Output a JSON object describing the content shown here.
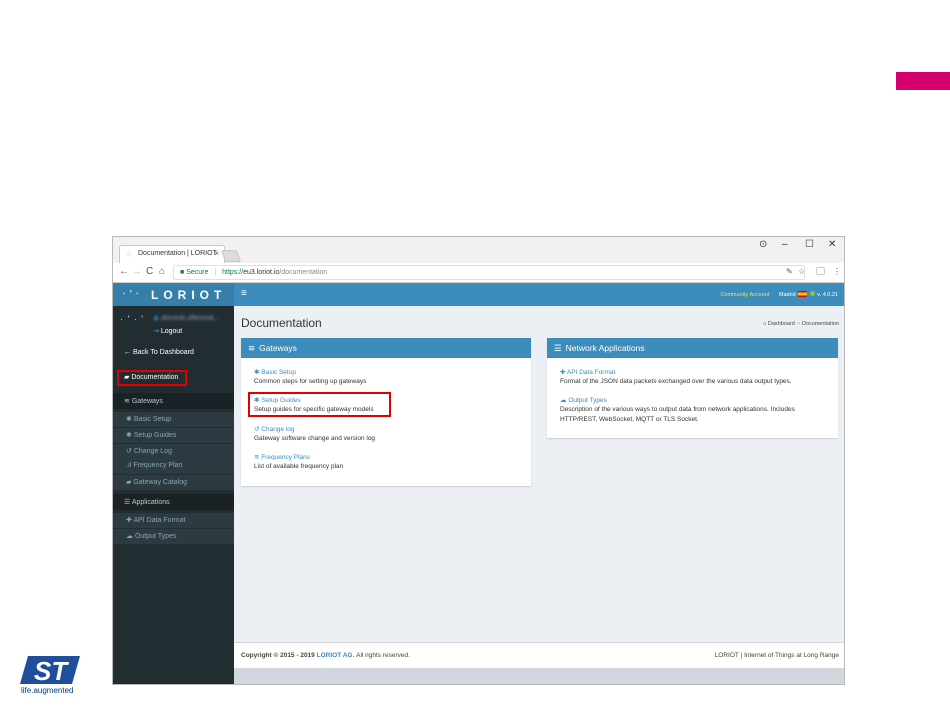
{
  "browser": {
    "tab_title": "Documentation | LORIOT",
    "tab_close": "×",
    "window_controls": {
      "account": "⊙",
      "minimize": "–",
      "maximize": "☐",
      "close": "✕"
    },
    "nav": {
      "back": "←",
      "forward": "→",
      "reload": "C",
      "home": "⌂"
    },
    "url": {
      "lock": "🔒",
      "secure_label": "Secure",
      "protocol": "https://",
      "host": "eu3.loriot.io",
      "path": "/documentation"
    },
    "omni_icons": {
      "translate": "✎",
      "star": "☆",
      "menu": "⋮"
    }
  },
  "sidebar": {
    "logo_text": "LORIOT",
    "logo_dots": "· ' ·",
    "user_dots": "· ' · '",
    "user_name": "dominik.oftenrod...",
    "logout": "Logout",
    "back_to_dashboard": "Back To Dashboard",
    "documentation": "Documentation",
    "gateways_header": "Gateways",
    "gateway_items": [
      "Basic Setup",
      "Setup Guides",
      "Change Log",
      "Frequency Plan",
      "Gateway Catalog"
    ],
    "applications_header": "Applications",
    "application_items": [
      "API Data Format",
      "Output Types"
    ]
  },
  "topbar": {
    "menu": "≡",
    "community": "Community Account",
    "location": "Madrid",
    "version": "v. 4.0.21"
  },
  "page": {
    "title": "Documentation",
    "breadcrumb_home": "Dashboard",
    "breadcrumb_sep": ">",
    "breadcrumb_current": "Documentation"
  },
  "gateways_box": {
    "title": "Gateways",
    "entries": [
      {
        "link": "Basic Setup",
        "desc": "Common steps for setting up gateways"
      },
      {
        "link": "Setup Guides",
        "desc": "Setup guides for specific gateway models"
      },
      {
        "link": "Change log",
        "desc": "Gateway software change and version log"
      },
      {
        "link": "Frequency Plans",
        "desc": "List of available frequency plan"
      }
    ]
  },
  "network_box": {
    "title": "Network Applications",
    "entries": [
      {
        "link": "API Data Format",
        "desc": "Format of the JSON data packets exchanged over the various data output types."
      },
      {
        "link": "Output Types",
        "desc": "Description of the various ways to output data from network applications. Includes",
        "desc2": "HTTP/REST, WebSocket, MQTT or TLS Socket."
      }
    ]
  },
  "footer": {
    "copyright_prefix": "Copyright © 2015 - 2019",
    "brand": "LORIOT AG.",
    "rights": "All rights reserved.",
    "tagline": "LORIOT | Internet of Things at Long Range"
  },
  "st": {
    "logo_text": "ST",
    "tagline": "life.augmented"
  },
  "colors": {
    "accent": "#3c8dbc",
    "sidebar": "#222d32",
    "highlight": "#e00000",
    "pink": "#d6006f"
  }
}
